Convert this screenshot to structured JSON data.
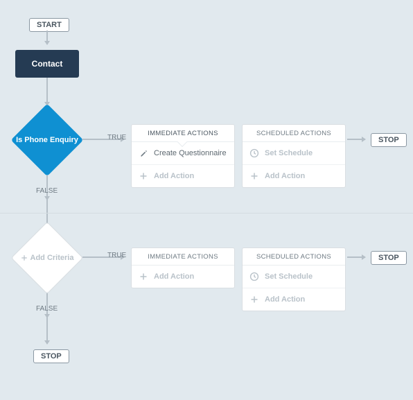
{
  "start": "START",
  "stop": "STOP",
  "contact": "Contact",
  "branch1": {
    "criteria": "Is Phone Enquiry",
    "true": "TRUE",
    "false": "FALSE",
    "immediate": {
      "title": "IMMEDIATE ACTIONS",
      "rows": [
        "Create Questionnaire",
        "Add Action"
      ]
    },
    "scheduled": {
      "title": "SCHEDULED ACTIONS",
      "rows": [
        "Set Schedule",
        "Add Action"
      ]
    }
  },
  "branch2": {
    "criteria": "Add Criteria",
    "true": "TRUE",
    "false": "FALSE",
    "immediate": {
      "title": "IMMEDIATE ACTIONS",
      "rows": [
        "Add Action"
      ]
    },
    "scheduled": {
      "title": "SCHEDULED ACTIONS",
      "rows": [
        "Set Schedule",
        "Add Action"
      ]
    }
  }
}
